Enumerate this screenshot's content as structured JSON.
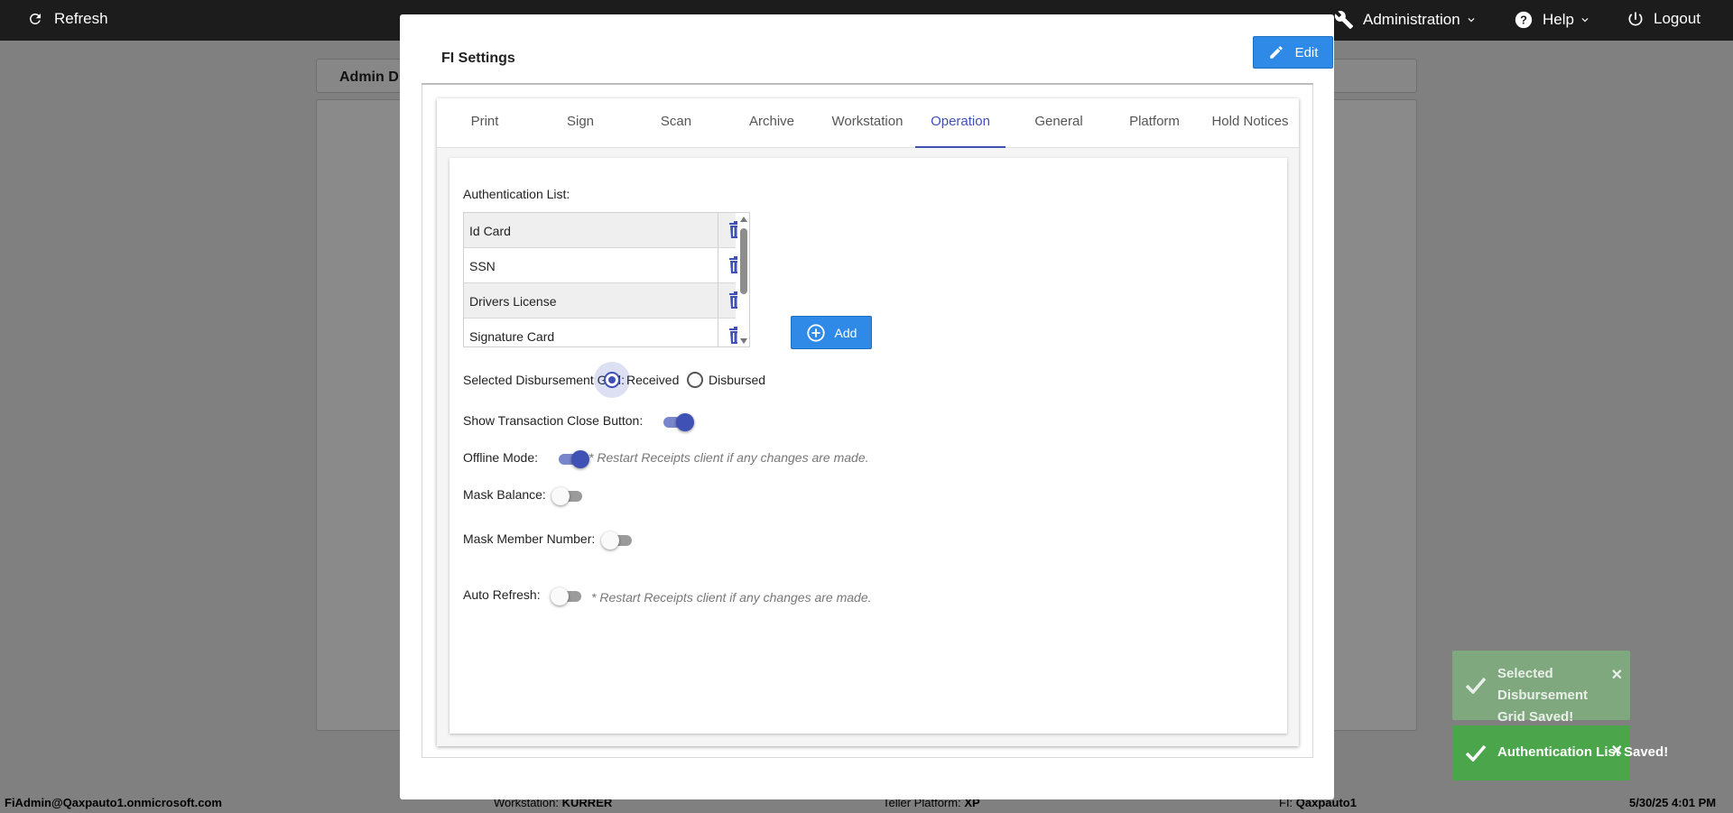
{
  "topbar": {
    "refresh_label": "Refresh",
    "administration_label": "Administration",
    "help_label": "Help",
    "logout_label": "Logout"
  },
  "background": {
    "tab_label": "Admin D"
  },
  "statusbar": {
    "user": "FiAdmin@Qaxpauto1.onmicrosoft.com",
    "workstation_label": "Workstation:",
    "workstation_value": "KURRER",
    "platform_label": "Teller Platform:",
    "platform_value": "XP",
    "fi_label": "FI:",
    "fi_value": "Qaxpauto1",
    "datetime": "5/30/25 4:01 PM"
  },
  "modal": {
    "title": "FI Settings",
    "edit_label": "Edit"
  },
  "tabs": [
    "Print",
    "Sign",
    "Scan",
    "Archive",
    "Workstation",
    "Operation",
    "General",
    "Platform",
    "Hold Notices"
  ],
  "active_tab": "Operation",
  "operation": {
    "auth_list_label": "Authentication List:",
    "auth_items": [
      "Id Card",
      "SSN",
      "Drivers License",
      "Signature Card"
    ],
    "add_label": "Add",
    "disbursement_label": "Selected Disbursement Grid:",
    "received_label": "Received",
    "disbursed_label": "Disbursed",
    "disbursement_selected": "Received",
    "close_button_label": "Show Transaction Close Button:",
    "close_button_on": true,
    "offline_label": "Offline Mode:",
    "offline_on": true,
    "offline_note": "* Restart Receipts client if any changes are made.",
    "mask_balance_label": "Mask Balance:",
    "mask_balance_on": false,
    "mask_member_label": "Mask Member Number:",
    "mask_member_on": false,
    "auto_refresh_label": "Auto Refresh:",
    "auto_refresh_on": false,
    "auto_refresh_note": "* Restart Receipts client if any changes are made."
  },
  "toasts": [
    {
      "message": "Selected Disbursement Grid Saved!",
      "state": "fading"
    },
    {
      "message": "Authentication List Saved!",
      "state": "active"
    }
  ],
  "colors": {
    "primary_button": "#2e8ae6",
    "accent": "#3f51b5",
    "toast_success": "#4ba64b"
  }
}
